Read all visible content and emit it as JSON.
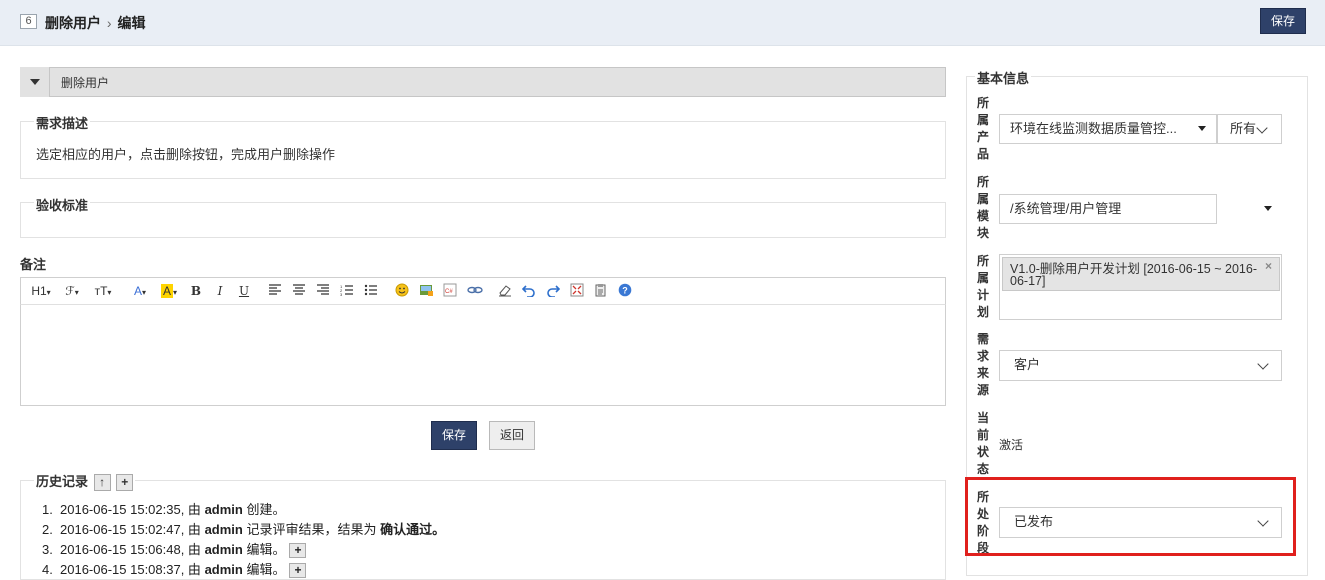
{
  "header": {
    "id": "6",
    "breadcrumb_title": "删除用户",
    "breadcrumb_sep": "›",
    "breadcrumb_action": "编辑",
    "save_label": "保存"
  },
  "story": {
    "title": "删除用户",
    "description_legend": "需求描述",
    "description_text": "选定相应的用户，点击删除按钮，完成用户删除操作",
    "acceptance_legend": "验收标准",
    "remark_label": "备注"
  },
  "editor": {
    "heading": "H1",
    "font": "ℱ",
    "size": "ᴛT",
    "font_color": "A",
    "bg_color": "A",
    "bold": "B",
    "italic": "I",
    "underline": "U"
  },
  "actions": {
    "save_label": "保存",
    "back_label": "返回"
  },
  "history": {
    "legend": "历史记录",
    "up_btn": "↑",
    "expand_btn": "+",
    "items": [
      {
        "num": "1.",
        "time": "2016-06-15 15:02:35, 由 ",
        "user": "admin",
        "action": " 创建。",
        "extra": "",
        "extra_bold": "",
        "has_plus": false
      },
      {
        "num": "2.",
        "time": "2016-06-15 15:02:47, 由 ",
        "user": "admin",
        "action": " 记录评审结果，结果为 ",
        "extra_bold": "确认通过。",
        "has_plus": false
      },
      {
        "num": "3.",
        "time": "2016-06-15 15:06:48, 由 ",
        "user": "admin",
        "action": " 编辑。",
        "extra_bold": "",
        "has_plus": true
      },
      {
        "num": "4.",
        "time": "2016-06-15 15:08:37, 由 ",
        "user": "admin",
        "action": " 编辑。",
        "extra_bold": "",
        "has_plus": true
      }
    ]
  },
  "basic_info": {
    "legend": "基本信息",
    "product_label": "所属产品",
    "product_value": "环境在线监测数据质量管控...",
    "product_branch": "所有",
    "module_label": "所属模块",
    "module_value": "/系统管理/用户管理",
    "plan_label": "所属计划",
    "plan_value": "V1.0-删除用户开发计划 [2016-06-15 ~ 2016-06-17]",
    "plan_remove": "×",
    "source_label": "需求来源",
    "source_value": "客户",
    "status_label": "当前状态",
    "status_value": "激活",
    "stage_label": "所处阶段",
    "stage_value": "已发布"
  },
  "colors": {
    "primary_button": "#2e4169",
    "header_bg": "#e9eef5",
    "highlight_border": "#e0201d"
  }
}
